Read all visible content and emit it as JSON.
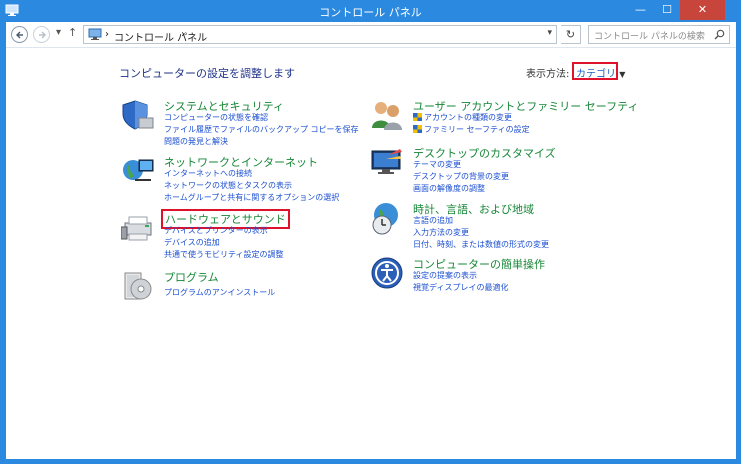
{
  "window": {
    "title": "コントロール パネル",
    "min": "—",
    "max": "☐",
    "close": "✕"
  },
  "nav": {
    "up": "↑",
    "dropdown": "▾",
    "breadcrumb": [
      "コントロール パネル"
    ],
    "sep": "›",
    "refresh": "↻",
    "search_placeholder": "コントロール パネルの検索"
  },
  "main": {
    "heading": "コンピューターの設定を調整します",
    "view_label": "表示方法:",
    "view_value": "カテゴリ",
    "view_caret": "▼",
    "left": [
      {
        "icon": "system-security-icon",
        "title": "システムとセキュリティ",
        "links": [
          "コンピューターの状態を確認",
          "ファイル履歴でファイルのバックアップ コピーを保存",
          "問題の発見と解決"
        ]
      },
      {
        "icon": "network-icon",
        "title": "ネットワークとインターネット",
        "links": [
          "インターネットへの接続",
          "ネットワークの状態とタスクの表示",
          "ホームグループと共有に関するオプションの選択"
        ]
      },
      {
        "icon": "hardware-sound-icon",
        "title": "ハードウェアとサウンド",
        "links": [
          "デバイスとプリンターの表示",
          "デバイスの追加",
          "共通で使うモビリティ設定の調整"
        ]
      },
      {
        "icon": "programs-icon",
        "title": "プログラム",
        "links": [
          "プログラムのアンインストール"
        ]
      }
    ],
    "right": [
      {
        "icon": "user-accounts-icon",
        "title": "ユーザー アカウントとファミリー セーフティ",
        "links": [
          "アカウントの種類の変更",
          "ファミリー セーフティの設定"
        ]
      },
      {
        "icon": "appearance-icon",
        "title": "デスクトップのカスタマイズ",
        "links": [
          "テーマの変更",
          "デスクトップの背景の変更",
          "画面の解像度の調整"
        ]
      },
      {
        "icon": "clock-region-icon",
        "title": "時計、言語、および地域",
        "links": [
          "言語の追加",
          "入力方法の変更",
          "日付、時刻、または数値の形式の変更"
        ]
      },
      {
        "icon": "ease-of-access-icon",
        "title": "コンピューターの簡単操作",
        "links": [
          "設定の提案の表示",
          "視覚ディスプレイの最適化"
        ]
      }
    ]
  },
  "colors": {
    "titlebar": "#2b8ae0",
    "close": "#c7453b",
    "category": "#168736",
    "link": "#1a4ed0",
    "highlight": "#e0112b"
  }
}
